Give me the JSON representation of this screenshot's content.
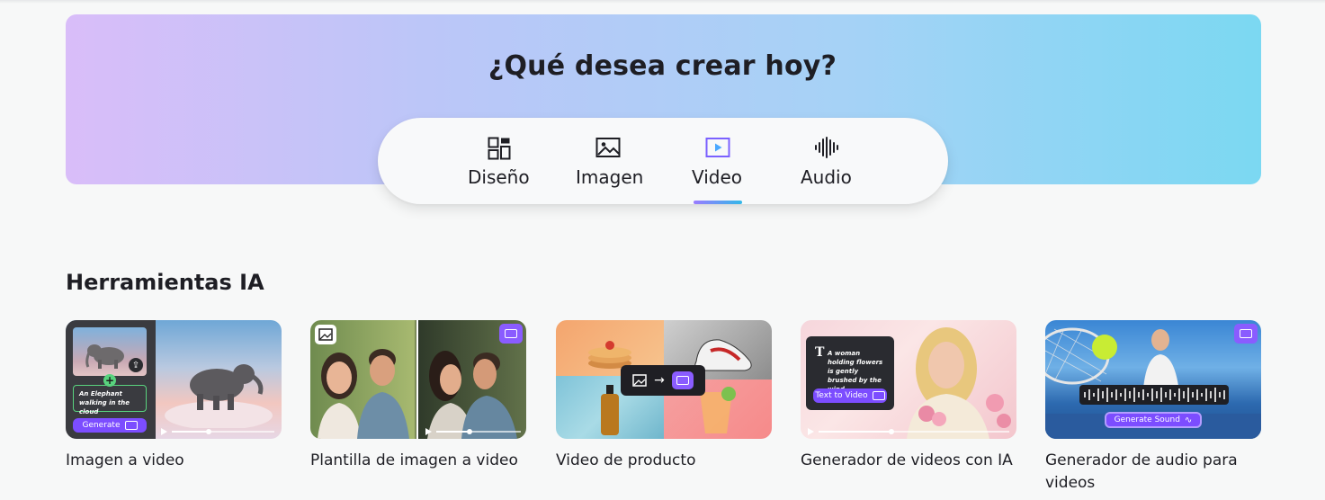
{
  "hero": {
    "title": "¿Qué desea crear hoy?",
    "tabs": [
      {
        "label": "Diseño",
        "icon": "design-layout-icon",
        "active": false
      },
      {
        "label": "Imagen",
        "icon": "image-icon",
        "active": false
      },
      {
        "label": "Video",
        "icon": "video-icon",
        "active": true
      },
      {
        "label": "Audio",
        "icon": "audio-waveform-icon",
        "active": false
      }
    ]
  },
  "section": {
    "title": "Herramientas IA"
  },
  "cards": [
    {
      "label": "Imagen a video",
      "thumb": {
        "prompt": "An Elephant walking in the cloud",
        "button": "Generate"
      }
    },
    {
      "label": "Plantilla de imagen a video",
      "thumb": {}
    },
    {
      "label": "Video de producto",
      "thumb": {}
    },
    {
      "label": "Generador de videos con IA",
      "thumb": {
        "prompt": "A woman holding flowers is gently brushed by the wind",
        "button": "Text to Video"
      }
    },
    {
      "label": "Generador de audio para videos",
      "thumb": {
        "button": "Generate Sound"
      }
    }
  ],
  "colors": {
    "accent_purple": "#7c4dff",
    "hero_gradient_start": "#d9bdf9",
    "hero_gradient_end": "#7bd8f2",
    "active_video_icon": "#7b61ff"
  }
}
